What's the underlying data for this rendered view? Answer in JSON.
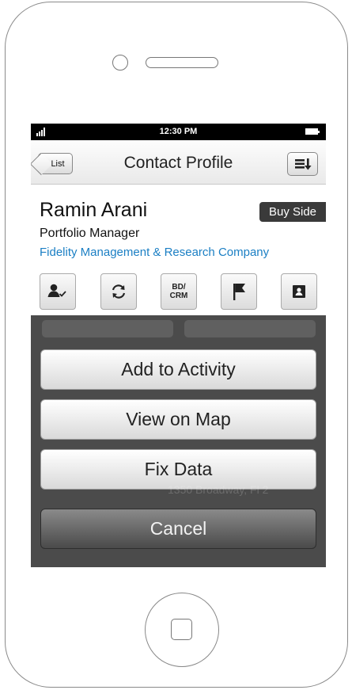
{
  "status_bar": {
    "time": "12:30 PM"
  },
  "nav": {
    "back_label": "List",
    "title": "Contact Profile"
  },
  "contact": {
    "name": "Ramin Arani",
    "badge": "Buy Side",
    "title": "Portfolio Manager",
    "company": "Fidelity Management & Research Company"
  },
  "action_icons": [
    {
      "name": "assign-contact-icon"
    },
    {
      "name": "sync-icon"
    },
    {
      "name": "bd-crm-icon",
      "label_line1": "BD/",
      "label_line2": "CRM"
    },
    {
      "name": "flag-icon"
    },
    {
      "name": "contact-card-icon"
    }
  ],
  "background_text": "1350 Broadway, Fl 2",
  "action_sheet": {
    "add_to_activity": "Add to Activity",
    "view_on_map": "View on Map",
    "fix_data": "Fix Data",
    "cancel": "Cancel"
  },
  "colors": {
    "link": "#1b7fc4",
    "badge_bg": "#3a3a3a",
    "overlay": "#2d2d2d"
  }
}
